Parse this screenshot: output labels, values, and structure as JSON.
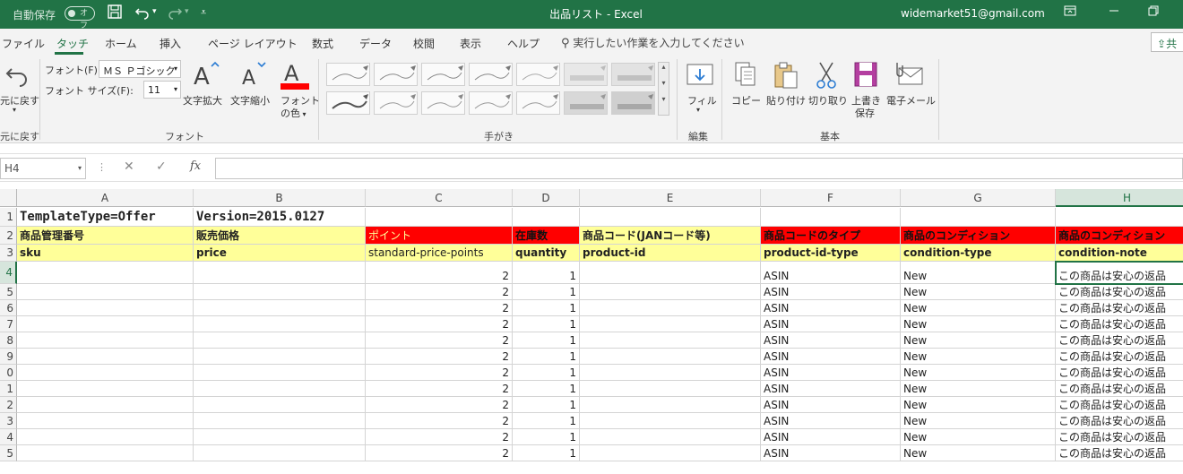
{
  "titlebar": {
    "autosave_label": "自動保存",
    "autosave_state": "オフ",
    "title": "出品リスト  -  Excel",
    "user": "widemarket51@gmail.com"
  },
  "menu": {
    "tabs": [
      "ファイル",
      "タッチ",
      "ホーム",
      "挿入",
      "ページ レイアウト",
      "数式",
      "データ",
      "校閲",
      "表示",
      "ヘルプ"
    ],
    "active_tab": "タッチ",
    "tell_me": "実行したい作業を入力してください",
    "share": "共"
  },
  "ribbon": {
    "undo_label": "元に戻す",
    "undo_group": "元に戻す",
    "font_label": "フォント(F):",
    "font_value": "ＭＳ Ｐゴシック",
    "size_label": "フォント サイズ(F):",
    "size_value": "11",
    "grow_label": "文字拡大",
    "shrink_label": "文字縮小",
    "color_label1": "フォント",
    "color_label2": "の色",
    "font_group": "フォント",
    "ink_group": "手がき",
    "fill_label": "フィル",
    "edit_group": "編集",
    "copy_label": "コピー",
    "paste_label": "貼り付け",
    "cut_label": "切り取り",
    "save_label1": "上書き",
    "save_label2": "保存",
    "email_label": "電子メール",
    "basic_group": "基本"
  },
  "formula_bar": {
    "name_box": "H4",
    "fx": "fx",
    "formula": ""
  },
  "sheet": {
    "columns": [
      "A",
      "B",
      "C",
      "D",
      "E",
      "F",
      "G",
      "H"
    ],
    "selected_column": "H",
    "row_numbers": [
      "1",
      "2",
      "3",
      "4",
      "5",
      "6",
      "7",
      "8",
      "9",
      "0",
      "1",
      "2",
      "3",
      "4",
      "5"
    ],
    "selected_row_index": 3,
    "row1": {
      "A": "TemplateType=Offer",
      "B": "Version=2015.0127"
    },
    "row2": {
      "A": "商品管理番号",
      "B": "販売価格",
      "C": "ポイント",
      "D": "在庫数",
      "E": "商品コード(JANコード等)",
      "F": "商品コードのタイプ",
      "G": "商品のコンディション",
      "H": "商品のコンディション"
    },
    "row3": {
      "A": "sku",
      "B": "price",
      "C": "standard-price-points",
      "D": "quantity",
      "E": "product-id",
      "F": "product-id-type",
      "G": "condition-type",
      "H": "condition-note"
    },
    "data_row": {
      "C": "2",
      "D": "1",
      "F": "ASIN",
      "G": "New",
      "H": "この商品は安心の返品"
    },
    "data_row_count": 12,
    "colors": {
      "header_red": "#ff0000",
      "header_yellow": "#ffff99",
      "excel_green": "#217346",
      "red_text": "#ff0000"
    }
  }
}
